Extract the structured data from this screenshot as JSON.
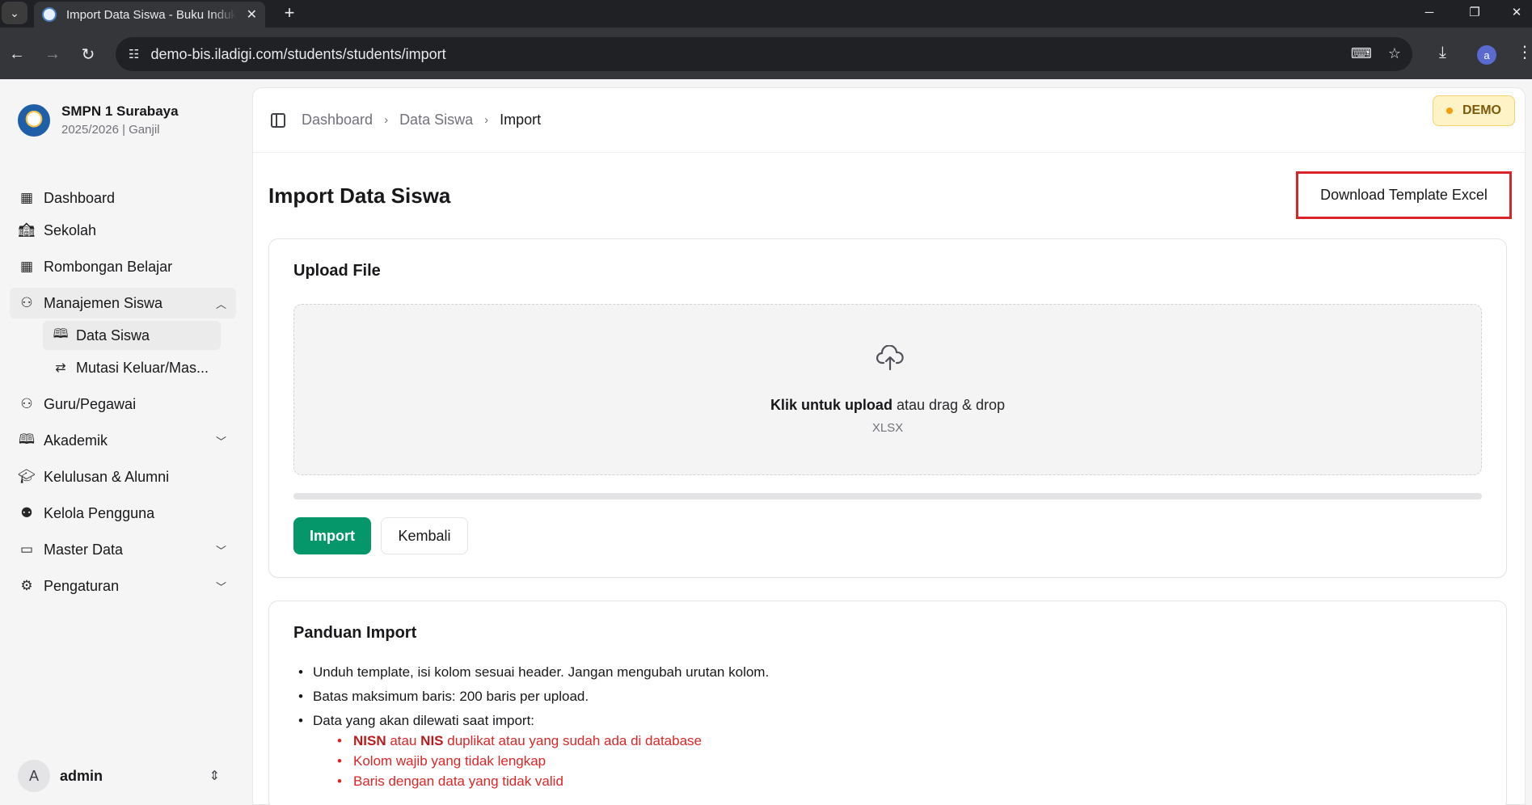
{
  "browser": {
    "tab_title": "Import Data Siswa - Buku Induk",
    "url": "demo-bis.iladigi.com/students/students/import",
    "profile_initial": "a"
  },
  "sidebar": {
    "school_name": "SMPN 1 Surabaya",
    "school_period": "2025/2026 | Ganjil",
    "items": [
      {
        "label": "Dashboard",
        "icon": "grid-icon"
      },
      {
        "label": "Sekolah",
        "icon": "school-icon"
      },
      {
        "label": "Rombongan Belajar",
        "icon": "grid-icon"
      },
      {
        "label": "Manajemen Siswa",
        "icon": "users-icon",
        "expanded": true
      },
      {
        "label": "Guru/Pegawai",
        "icon": "users-icon"
      },
      {
        "label": "Akademik",
        "icon": "book-icon"
      },
      {
        "label": "Kelulusan & Alumni",
        "icon": "graduation-cap-icon"
      },
      {
        "label": "Kelola Pengguna",
        "icon": "user-cog-icon"
      },
      {
        "label": "Master Data",
        "icon": "folder-icon"
      },
      {
        "label": "Pengaturan",
        "icon": "gear-icon"
      }
    ],
    "sub_items": [
      {
        "label": "Data Siswa",
        "icon": "book-open-icon",
        "active": true
      },
      {
        "label": "Mutasi Keluar/Mas...",
        "icon": "arrows-swap-icon"
      }
    ],
    "user": {
      "initial": "A",
      "name": "admin"
    }
  },
  "header": {
    "breadcrumb": [
      "Dashboard",
      "Data Siswa",
      "Import"
    ],
    "badge": "DEMO"
  },
  "page": {
    "title": "Import Data Siswa",
    "download_button": "Download Template Excel"
  },
  "upload": {
    "title": "Upload File",
    "cta_bold": "Klik untuk upload",
    "cta_rest": " atau drag & drop",
    "file_types": "XLSX",
    "progress": 0,
    "import_button": "Import",
    "back_button": "Kembali"
  },
  "guide": {
    "title": "Panduan Import",
    "items": [
      "Unduh template, isi kolom sesuai header. Jangan mengubah urutan kolom.",
      "Batas maksimum baris: 200 baris per upload.",
      "Data yang akan dilewati saat import:"
    ],
    "skip_first": {
      "b1": "NISN",
      "t1": " atau ",
      "b2": "NIS",
      "t2": " duplikat atau yang sudah ada di database"
    },
    "skip_items": [
      "Kolom wajib yang tidak lengkap",
      "Baris dengan data yang tidak valid"
    ]
  },
  "colors": {
    "primary": "#059669",
    "highlight_border": "#d9252a",
    "demo_badge": "#fef3c7",
    "error_text": "#dc2626"
  }
}
